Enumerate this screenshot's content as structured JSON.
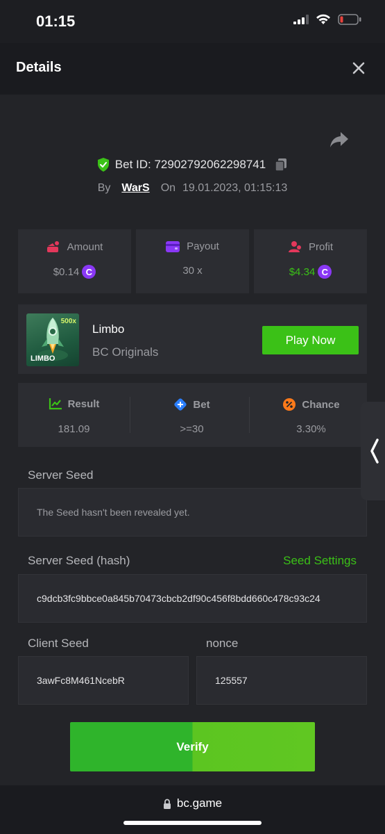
{
  "status_bar": {
    "time": "01:15"
  },
  "header": {
    "title": "Details"
  },
  "bet": {
    "id_label": "Bet ID: 72902792062298741",
    "by_label": "By",
    "user": "WarS",
    "on_label": "On",
    "date": "19.01.2023, 01:15:13"
  },
  "stats": [
    {
      "label": "Amount",
      "value": "$0.14"
    },
    {
      "label": "Payout",
      "value": "30 x"
    },
    {
      "label": "Profit",
      "value": "$4.34"
    }
  ],
  "game": {
    "name": "Limbo",
    "provider": "BC Originals",
    "thumb_title": "LIMBO",
    "thumb_badge": "500x",
    "play_label": "Play Now"
  },
  "results": [
    {
      "label": "Result",
      "value": "181.09"
    },
    {
      "label": "Bet",
      "value": ">=30"
    },
    {
      "label": "Chance",
      "value": "3.30%"
    }
  ],
  "server_seed": {
    "label": "Server Seed",
    "value": "The Seed hasn't been revealed yet."
  },
  "server_seed_hash": {
    "label": "Server Seed (hash)",
    "settings_label": "Seed Settings",
    "value": "c9dcb3fc9bbce0a845b70473cbcb2df90c456f8bdd660c478c93c24"
  },
  "client_seed": {
    "label": "Client Seed",
    "value": "3awFc8M461NcebR"
  },
  "nonce": {
    "label": "nonce",
    "value": "125557"
  },
  "verify_label": "Verify",
  "footer": {
    "url": "bc.game"
  },
  "colors": {
    "accent_green": "#3bc117",
    "coin_purple": "#8a38f5",
    "background": "#232428"
  },
  "coin_symbol": "C"
}
